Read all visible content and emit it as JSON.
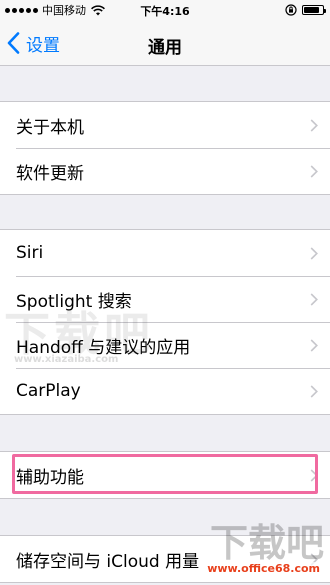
{
  "status_bar": {
    "carrier": "中国移动",
    "time": "下午4:16",
    "battery_level": 0.85
  },
  "nav": {
    "back_label": "设置",
    "title": "通用"
  },
  "groups": [
    {
      "items": [
        "关于本机",
        "软件更新"
      ]
    },
    {
      "items": [
        "Siri",
        "Spotlight 搜索",
        "Handoff 与建议的应用",
        "CarPlay"
      ]
    },
    {
      "items": [
        "辅助功能"
      ]
    },
    {
      "items": [
        "储存空间与 iCloud 用量"
      ]
    }
  ],
  "watermarks": {
    "left": "下载吧",
    "left_url": "www.xiazaiba.com",
    "right": "下载吧",
    "site": "www.office68.com"
  },
  "colors": {
    "accent": "#007aff",
    "highlight": "#f06aa0",
    "background": "#efeff4",
    "separator": "#c8c7cc"
  }
}
